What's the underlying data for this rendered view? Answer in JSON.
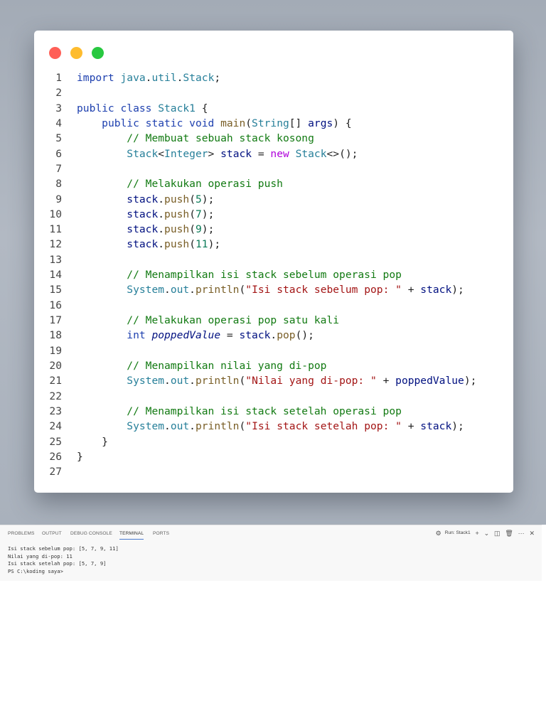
{
  "editor": {
    "window_dots": [
      "close",
      "minimize",
      "maximize"
    ],
    "lines": [
      {
        "n": "1",
        "tokens": [
          [
            "kw",
            "import "
          ],
          [
            "ty",
            "java"
          ],
          [
            "",
            "."
          ],
          [
            "ty",
            "util"
          ],
          [
            "",
            "."
          ],
          [
            "ty",
            "Stack"
          ],
          [
            "",
            ";"
          ]
        ]
      },
      {
        "n": "2",
        "tokens": []
      },
      {
        "n": "3",
        "tokens": [
          [
            "kw",
            "public class "
          ],
          [
            "ty",
            "Stack1"
          ],
          [
            "",
            " {"
          ]
        ]
      },
      {
        "n": "4",
        "tokens": [
          [
            "",
            "    "
          ],
          [
            "kw",
            "public static void "
          ],
          [
            "fn",
            "main"
          ],
          [
            "",
            "("
          ],
          [
            "ty",
            "String"
          ],
          [
            "",
            "[] "
          ],
          [
            "va",
            "args"
          ],
          [
            "",
            ") {"
          ]
        ]
      },
      {
        "n": "5",
        "tokens": [
          [
            "",
            "        "
          ],
          [
            "cm",
            "// Membuat sebuah stack kosong"
          ]
        ]
      },
      {
        "n": "6",
        "tokens": [
          [
            "",
            "        "
          ],
          [
            "ty",
            "Stack"
          ],
          [
            "",
            "<"
          ],
          [
            "ty",
            "Integer"
          ],
          [
            "",
            "> "
          ],
          [
            "va",
            "stack"
          ],
          [
            "",
            " = "
          ],
          [
            "ne",
            "new "
          ],
          [
            "ty",
            "Stack"
          ],
          [
            "",
            "<>();"
          ]
        ]
      },
      {
        "n": "7",
        "tokens": []
      },
      {
        "n": "8",
        "tokens": [
          [
            "",
            "        "
          ],
          [
            "cm",
            "// Melakukan operasi push"
          ]
        ]
      },
      {
        "n": "9",
        "tokens": [
          [
            "",
            "        "
          ],
          [
            "va",
            "stack"
          ],
          [
            "",
            "."
          ],
          [
            "fn",
            "push"
          ],
          [
            "",
            "("
          ],
          [
            "nu",
            "5"
          ],
          [
            "",
            ");"
          ]
        ]
      },
      {
        "n": "10",
        "tokens": [
          [
            "",
            "        "
          ],
          [
            "va",
            "stack"
          ],
          [
            "",
            "."
          ],
          [
            "fn",
            "push"
          ],
          [
            "",
            "("
          ],
          [
            "nu",
            "7"
          ],
          [
            "",
            ");"
          ]
        ]
      },
      {
        "n": "11",
        "tokens": [
          [
            "",
            "        "
          ],
          [
            "va",
            "stack"
          ],
          [
            "",
            "."
          ],
          [
            "fn",
            "push"
          ],
          [
            "",
            "("
          ],
          [
            "nu",
            "9"
          ],
          [
            "",
            ");"
          ]
        ]
      },
      {
        "n": "12",
        "tokens": [
          [
            "",
            "        "
          ],
          [
            "va",
            "stack"
          ],
          [
            "",
            "."
          ],
          [
            "fn",
            "push"
          ],
          [
            "",
            "("
          ],
          [
            "nu",
            "11"
          ],
          [
            "",
            ");"
          ]
        ]
      },
      {
        "n": "13",
        "tokens": []
      },
      {
        "n": "14",
        "tokens": [
          [
            "",
            "        "
          ],
          [
            "cm",
            "// Menampilkan isi stack sebelum operasi pop"
          ]
        ]
      },
      {
        "n": "15",
        "tokens": [
          [
            "",
            "        "
          ],
          [
            "ty",
            "System"
          ],
          [
            "",
            "."
          ],
          [
            "ty",
            "out"
          ],
          [
            "",
            "."
          ],
          [
            "fn",
            "println"
          ],
          [
            "",
            "("
          ],
          [
            "st",
            "\"Isi stack sebelum pop: \""
          ],
          [
            "",
            " + "
          ],
          [
            "va",
            "stack"
          ],
          [
            "",
            ");"
          ]
        ]
      },
      {
        "n": "16",
        "tokens": []
      },
      {
        "n": "17",
        "tokens": [
          [
            "",
            "        "
          ],
          [
            "cm",
            "// Melakukan operasi pop satu kali"
          ]
        ]
      },
      {
        "n": "18",
        "tokens": [
          [
            "",
            "        "
          ],
          [
            "kw",
            "int "
          ],
          [
            "it",
            "poppedValue"
          ],
          [
            "",
            " = "
          ],
          [
            "va",
            "stack"
          ],
          [
            "",
            "."
          ],
          [
            "fn",
            "pop"
          ],
          [
            "",
            "();"
          ]
        ]
      },
      {
        "n": "19",
        "tokens": []
      },
      {
        "n": "20",
        "tokens": [
          [
            "",
            "        "
          ],
          [
            "cm",
            "// Menampilkan nilai yang di-pop"
          ]
        ]
      },
      {
        "n": "21",
        "tokens": [
          [
            "",
            "        "
          ],
          [
            "ty",
            "System"
          ],
          [
            "",
            "."
          ],
          [
            "ty",
            "out"
          ],
          [
            "",
            "."
          ],
          [
            "fn",
            "println"
          ],
          [
            "",
            "("
          ],
          [
            "st",
            "\"Nilai yang di-pop: \""
          ],
          [
            "",
            " + "
          ],
          [
            "va",
            "poppedValue"
          ],
          [
            "",
            ");"
          ]
        ]
      },
      {
        "n": "22",
        "tokens": []
      },
      {
        "n": "23",
        "tokens": [
          [
            "",
            "        "
          ],
          [
            "cm",
            "// Menampilkan isi stack setelah operasi pop"
          ]
        ]
      },
      {
        "n": "24",
        "tokens": [
          [
            "",
            "        "
          ],
          [
            "ty",
            "System"
          ],
          [
            "",
            "."
          ],
          [
            "ty",
            "out"
          ],
          [
            "",
            "."
          ],
          [
            "fn",
            "println"
          ],
          [
            "",
            "("
          ],
          [
            "st",
            "\"Isi stack setelah pop: \""
          ],
          [
            "",
            " + "
          ],
          [
            "va",
            "stack"
          ],
          [
            "",
            ");"
          ]
        ]
      },
      {
        "n": "25",
        "tokens": [
          [
            "",
            "    }"
          ]
        ]
      },
      {
        "n": "26",
        "tokens": [
          [
            "",
            "}"
          ]
        ]
      },
      {
        "n": "27",
        "tokens": []
      }
    ]
  },
  "panel": {
    "tabs": [
      "PROBLEMS",
      "OUTPUT",
      "DEBUG CONSOLE",
      "TERMINAL",
      "PORTS"
    ],
    "active_tab": "TERMINAL",
    "actions": {
      "run_label": "Run: Stack1",
      "add": "+",
      "dropdown": "⌄",
      "split": "◫",
      "trash": "🗑",
      "more": "···",
      "close": "✕"
    },
    "terminal_lines": [
      "Isi stack sebelum pop: [5, 7, 9, 11]",
      "Nilai yang di-pop: 11",
      "Isi stack setelah pop: [5, 7, 9]",
      "PS C:\\koding saya>"
    ]
  },
  "colors": {
    "keyword": "#1e40af",
    "type": "#267f99",
    "function": "#795e26",
    "comment": "#127a12",
    "string": "#a31515",
    "variable": "#001080",
    "number": "#0a7a57",
    "new_keyword": "#af00db",
    "dot_red": "#ff5f57",
    "dot_yellow": "#febc2e",
    "dot_green": "#28c840"
  }
}
